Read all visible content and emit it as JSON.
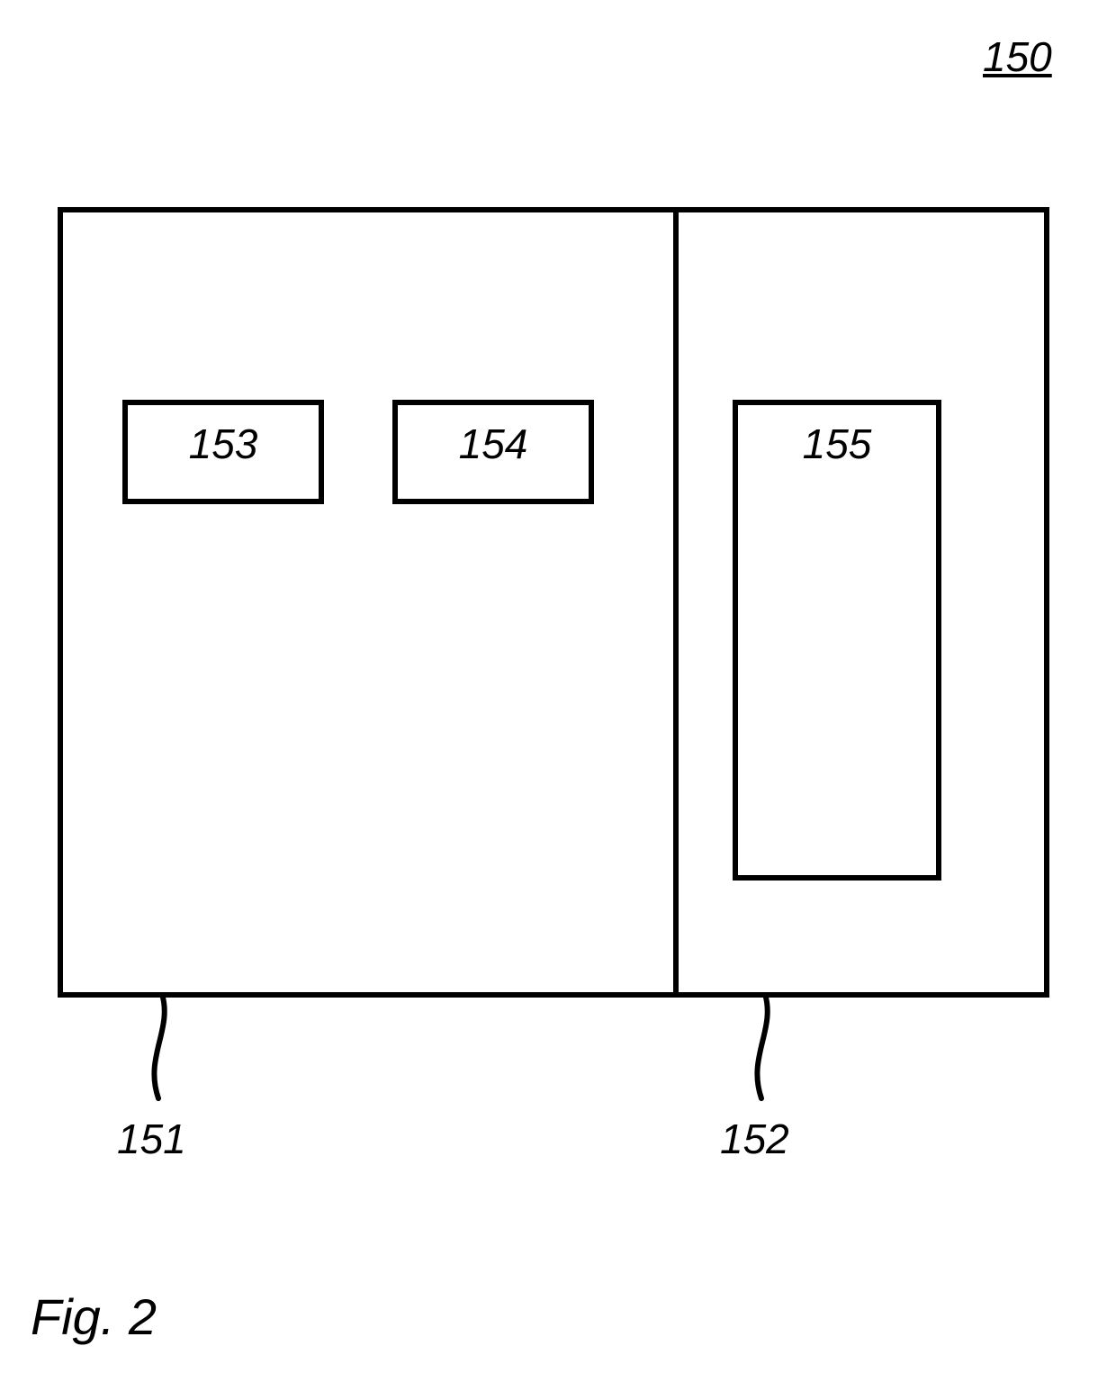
{
  "figure_ref": "150",
  "boxes": {
    "b153": "153",
    "b154": "154",
    "b155": "155"
  },
  "bottom_labels": {
    "l151": "151",
    "l152": "152"
  },
  "caption": "Fig. 2"
}
